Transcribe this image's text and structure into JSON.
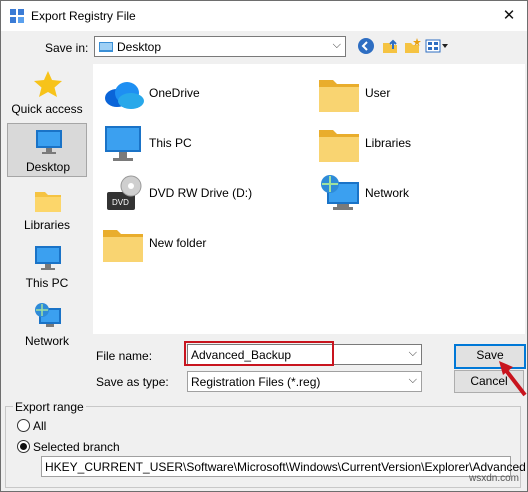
{
  "window": {
    "title": "Export Registry File",
    "close_glyph": "✕"
  },
  "save_in": {
    "label": "Save in:",
    "value": "Desktop"
  },
  "places": [
    {
      "label": "Quick access",
      "icon": "quick-access-star-icon",
      "selected": false
    },
    {
      "label": "Desktop",
      "icon": "desktop-icon",
      "selected": true
    },
    {
      "label": "Libraries",
      "icon": "libraries-icon",
      "selected": false
    },
    {
      "label": "This PC",
      "icon": "this-pc-icon",
      "selected": false
    },
    {
      "label": "Network",
      "icon": "network-icon",
      "selected": false
    }
  ],
  "files": [
    {
      "label": "OneDrive",
      "icon": "onedrive-cloud-icon"
    },
    {
      "label": "User",
      "icon": "folder-icon"
    },
    {
      "label": "This PC",
      "icon": "this-pc-icon"
    },
    {
      "label": "Libraries",
      "icon": "libraries-folder-icon"
    },
    {
      "label": "DVD RW Drive (D:)",
      "icon": "dvd-drive-icon",
      "badge": "DVD"
    },
    {
      "label": "Network",
      "icon": "network-icon"
    },
    {
      "label": "New folder",
      "icon": "folder-icon"
    }
  ],
  "file_name": {
    "label": "File name:",
    "value": "Advanced_Backup"
  },
  "save_as_type": {
    "label": "Save as type:",
    "value": "Registration Files (*.reg)"
  },
  "buttons": {
    "save": "Save",
    "cancel": "Cancel"
  },
  "export_range": {
    "label": "Export range",
    "all_label": "All",
    "selected_label": "Selected branch",
    "selected": "Selected branch",
    "branch_value": "HKEY_CURRENT_USER\\Software\\Microsoft\\Windows\\CurrentVersion\\Explorer\\Advanced"
  },
  "watermark": "wsxdn.com",
  "colors": {
    "accent": "#0078d7",
    "highlight": "#c8141e",
    "folder": "#f5c342"
  }
}
